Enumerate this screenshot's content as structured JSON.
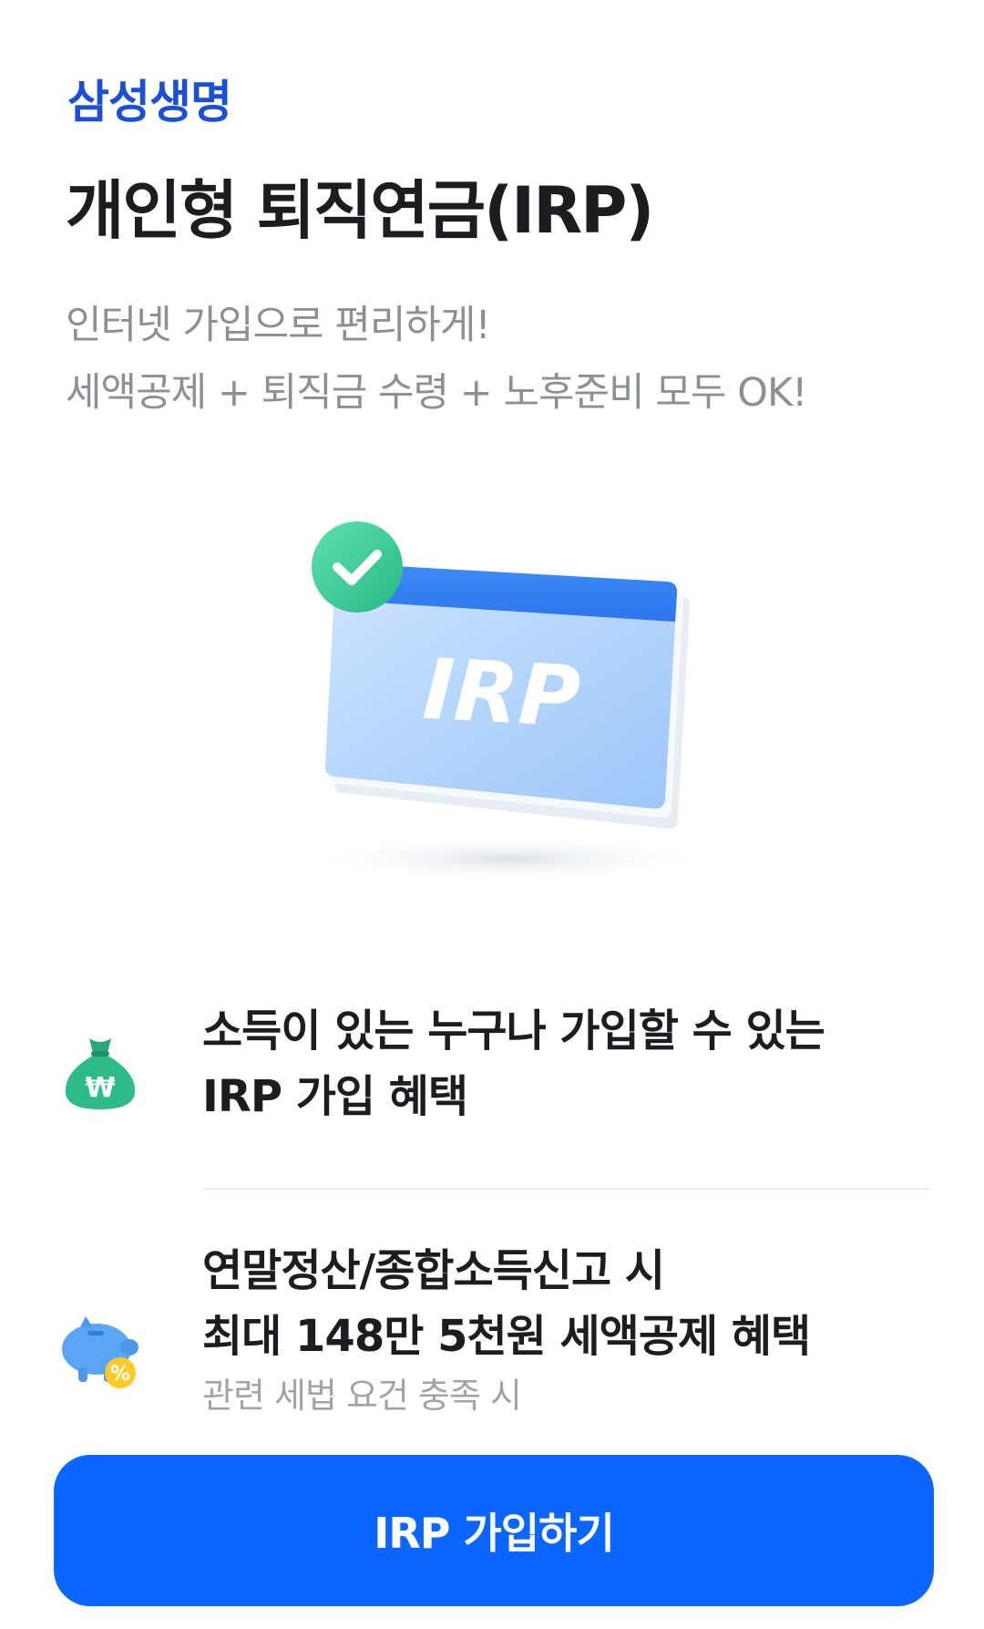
{
  "header": {
    "brand": "삼성생명",
    "title": "개인형 퇴직연금(IRP)",
    "subtitle_lines": [
      "인터넷 가입으로 편리하게!",
      "세액공제 + 퇴직금 수령 + 노후준비 모두 OK!"
    ]
  },
  "hero": {
    "card_text": "IRP",
    "icon": "calendar-check-icon"
  },
  "features": [
    {
      "icon": "money-bag-won-icon",
      "lines": [
        "소득이 있는 누구나 가입할 수 있는",
        "IRP 가입 혜택"
      ],
      "note": ""
    },
    {
      "icon": "piggy-bank-percent-icon",
      "lines": [
        "연말정산/종합소득신고 시",
        "최대 148만 5천원 세액공제 혜택"
      ],
      "note": "관련 세법 요건 충족 시"
    }
  ],
  "cta": {
    "label": "IRP 가입하기"
  },
  "colors": {
    "brand": "#1a4fd6",
    "cta": "#0a66ff",
    "title": "#1b1d21",
    "subtitle": "#8c9096",
    "green": "#2dbb8a"
  }
}
